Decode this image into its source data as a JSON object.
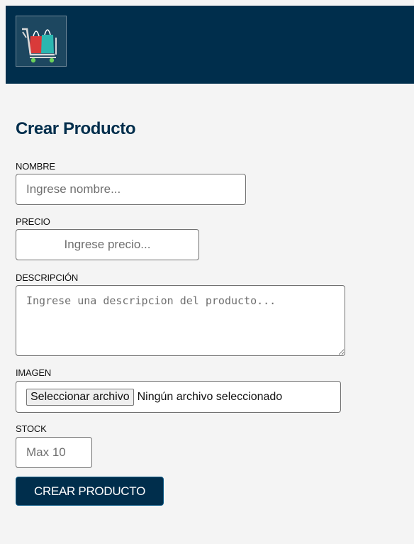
{
  "navbar": {
    "logo_icon": "shopping-cart-bags-icon"
  },
  "form": {
    "title": "Crear Producto",
    "nombre": {
      "label": "NOMBRE",
      "placeholder": "Ingrese nombre..."
    },
    "precio": {
      "label": "PRECIO",
      "placeholder": "Ingrese precio..."
    },
    "descripcion": {
      "label": "DESCRIPCIÓN",
      "placeholder": "Ingrese una descripcion del producto..."
    },
    "imagen": {
      "label": "IMAGEN",
      "button_label": "Seleccionar archivo",
      "status": "Ningún archivo seleccionado"
    },
    "stock": {
      "label": "STOCK",
      "placeholder": "Max 10"
    },
    "submit_label": "CREAR PRODUCTO"
  },
  "colors": {
    "navbar": "#002e4c",
    "page_background": "#f4f4f4",
    "button": "#002e4c"
  }
}
